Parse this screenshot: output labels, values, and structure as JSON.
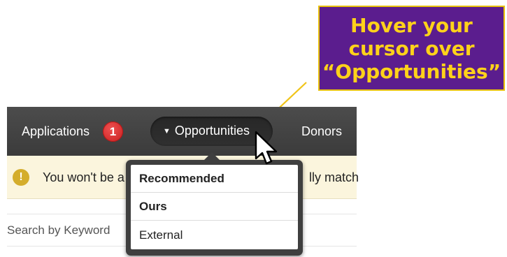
{
  "callout": {
    "text": "Hover your\ncursor over\n“Opportunities”",
    "bg_color": "#5b1d8e",
    "text_color": "#ffd21a",
    "border_color": "#e8c10b"
  },
  "nav": {
    "applications_label": "Applications",
    "applications_badge": "1",
    "opportunities_label": "Opportunities",
    "opportunities_arrow": "▼",
    "donors_label": "Donors",
    "bar_color": "#444444",
    "badge_color": "#d62d2d"
  },
  "alert": {
    "icon": "!",
    "text_visible": "You won't be a",
    "text_tail": "lly match"
  },
  "search": {
    "label": "Search by Keyword"
  },
  "dropdown": {
    "items": [
      {
        "label": "Recommended"
      },
      {
        "label": "Ours"
      },
      {
        "label": "External"
      }
    ]
  },
  "icons": {
    "pointer": "arrow-cursor-icon",
    "alert": "exclamation-circle-icon",
    "dropdown_arrow": "triangle-down-icon"
  }
}
